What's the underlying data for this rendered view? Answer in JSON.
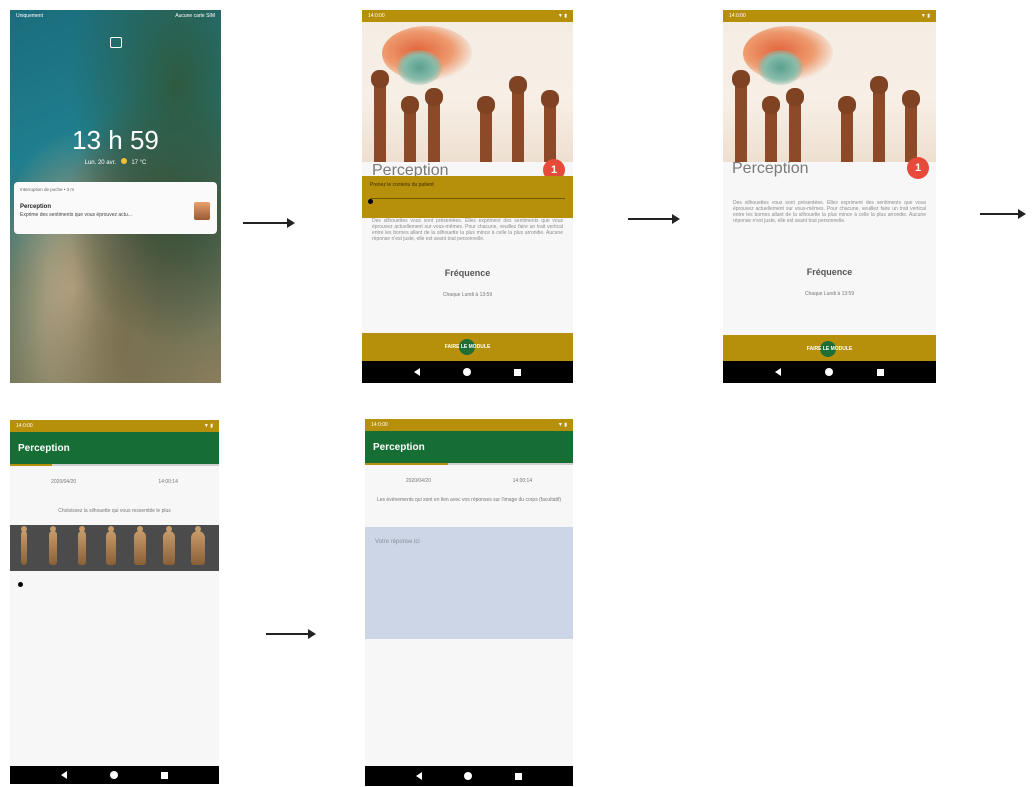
{
  "lockscreen": {
    "status_left": "Uniquement",
    "status_right": "Aucune carte SIM",
    "time": "13 h 59",
    "date": "Lun. 20 avr.",
    "weather": "17 °C",
    "notification": {
      "app": "Interruption de poche • 3 m",
      "title": "Perception",
      "body": "Exprime des sentiments que vous éprouvez actu..."
    }
  },
  "study_intro_overlay": {
    "status_time": "14:0:00",
    "title": "Perception",
    "badge": "1",
    "overlay_text": "Prenez le contenu du patient",
    "paragraph": "Des silhouettes vous sont présentées. Elles expriment des sentiments que vous éprouvez actuellement sur vous-mêmes. Pour chacune, veuillez faire un trait vertical entre les bornes allant de la silhouette la plus mince à celle la plus arrondie. Aucune réponse n'est juste, elle est avant tout personnelle.",
    "frequency_title": "Fréquence",
    "frequency_value": "Chaque Lundi à 13:59",
    "button": "FAIRE LE MODULE"
  },
  "study_intro": {
    "status_time": "14:0:00",
    "title": "Perception",
    "badge": "1",
    "paragraph": "Des silhouettes vous sont présentées. Elles expriment des sentiments que vous éprouvez actuellement sur vous-mêmes. Pour chacune, veuillez faire un trait vertical entre les bornes allant de la silhouette la plus mince à celle la plus arrondie. Aucune réponse n'est juste, elle est avant tout personnelle.",
    "frequency_title": "Fréquence",
    "frequency_value": "Chaque Lundi à 13:59",
    "button": "FAIRE LE MODULE"
  },
  "silhouette_screen": {
    "status_time": "14:0:00",
    "title": "Perception",
    "date": "2020/04/20",
    "time": "14:00:14",
    "progress": 0.2,
    "instruction": "Choisissez la silhouette qui vous ressemble le plus"
  },
  "text_answer_screen": {
    "status_time": "14:0:00",
    "title": "Perception",
    "date": "2020/04/20",
    "time": "14:00:14",
    "progress": 0.4,
    "instruction": "Les événements qui sont en lien avec vos réponses sur l'image du corps (facultatif)",
    "placeholder": "Votre réponse ici"
  },
  "colors": {
    "gold": "#b68f0b",
    "green": "#166e34",
    "badge_red": "#e64a3a",
    "answer_box": "#cdd6e6"
  }
}
